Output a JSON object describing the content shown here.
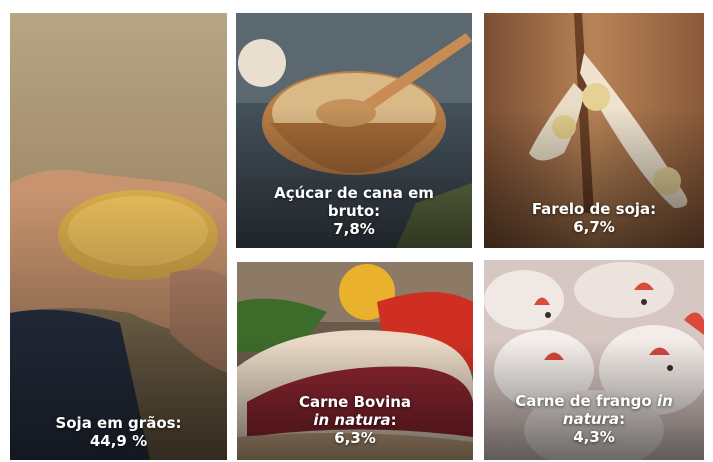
{
  "tiles": [
    {
      "id": "soja",
      "line1": "Soja em grãos:",
      "line2": "",
      "percent": "44,9 %"
    },
    {
      "id": "acucar",
      "line1": "Açúcar de cana em",
      "line2": "bruto:",
      "percent": "7,8%"
    },
    {
      "id": "farelo",
      "line1": "Farelo de soja:",
      "line2": "",
      "percent": "6,7%"
    },
    {
      "id": "bovina",
      "line1": "Carne Bovina",
      "line2_italic": "in natura",
      "line2_suffix": ":",
      "percent": "6,3%"
    },
    {
      "id": "frango",
      "line1": "Carne de frango",
      "line1_italic": "in",
      "line2_italic": "natura",
      "line2_suffix": ":",
      "percent": "4,3%"
    }
  ]
}
